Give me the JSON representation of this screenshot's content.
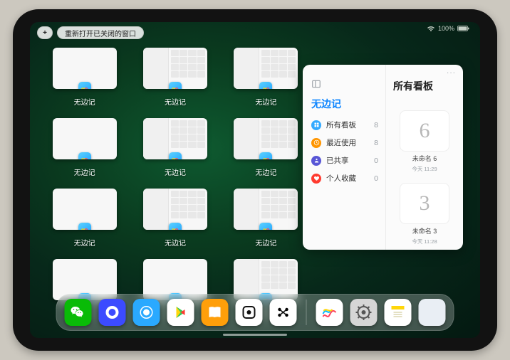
{
  "status": {
    "percent": "100%"
  },
  "top": {
    "plus": "+",
    "reopen_label": "重新打开已关闭的窗口"
  },
  "windows": {
    "label": "无边记",
    "items": [
      {
        "variant": "blank"
      },
      {
        "variant": "cal"
      },
      {
        "variant": "cal"
      },
      {
        "variant": "blank"
      },
      {
        "variant": "cal"
      },
      {
        "variant": "cal"
      },
      {
        "variant": "blank"
      },
      {
        "variant": "cal"
      },
      {
        "variant": "cal"
      },
      {
        "variant": "blank"
      },
      {
        "variant": "blank"
      },
      {
        "variant": "cal"
      }
    ]
  },
  "panel": {
    "left_title": "无边记",
    "right_title": "所有看板",
    "nav": [
      {
        "icon": "blue",
        "label": "所有看板",
        "count": "8"
      },
      {
        "icon": "orange",
        "label": "最近使用",
        "count": "8"
      },
      {
        "icon": "indigo",
        "label": "已共享",
        "count": "0"
      },
      {
        "icon": "red",
        "label": "个人收藏",
        "count": "0"
      }
    ],
    "boards": [
      {
        "glyph": "6",
        "label": "未命名 6",
        "sub": "今天 11:29"
      },
      {
        "glyph": "3",
        "label": "未命名 3",
        "sub": "今天 11:28"
      }
    ],
    "more": "···"
  },
  "dock": [
    {
      "name": "wechat",
      "bg": "#09bb07"
    },
    {
      "name": "quark",
      "bg": "#3c4bff"
    },
    {
      "name": "qqbrowser",
      "bg": "#2aa9ff"
    },
    {
      "name": "play",
      "bg": "#ffffff"
    },
    {
      "name": "books",
      "bg": "#ff9f0a"
    },
    {
      "name": "dot",
      "bg": "#ffffff"
    },
    {
      "name": "dots",
      "bg": "#ffffff"
    },
    {
      "name": "sep"
    },
    {
      "name": "freeform",
      "bg": "#ffffff"
    },
    {
      "name": "settings",
      "bg": "#d6d6d6"
    },
    {
      "name": "notes",
      "bg": "#ffffff"
    },
    {
      "name": "recent-stack"
    }
  ]
}
